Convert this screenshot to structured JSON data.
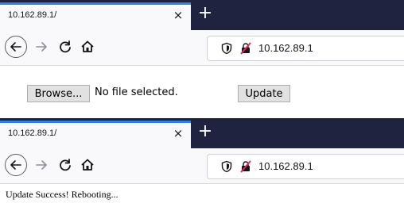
{
  "top_window": {
    "tab_title": "10.162.89.1/",
    "tab_close": "×",
    "new_tab": "+",
    "url": "10.162.89.1"
  },
  "page": {
    "browse_label": "Browse...",
    "no_file_text": "No file selected.",
    "update_label": "Update"
  },
  "bottom_window": {
    "tab_title": "10.162.89.1/",
    "tab_close": "×",
    "new_tab": "+",
    "url": "10.162.89.1"
  },
  "status": {
    "message": "Update Success! Rebooting..."
  },
  "colors": {
    "tabbar_bg": "#202340",
    "tab_accent": "#2d7fe0",
    "insecure_icon": "#e22850"
  }
}
